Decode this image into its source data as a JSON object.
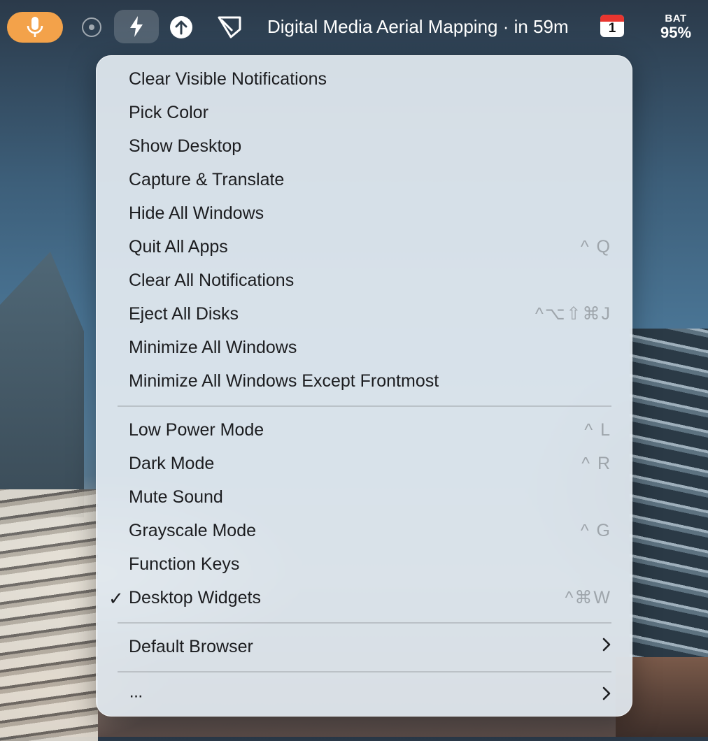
{
  "menubar": {
    "event_text": "Digital Media Aerial Mapping · in 59m",
    "calendar_day": "1",
    "battery_label": "BAT",
    "battery_percent": "95%",
    "mic_color": "#f3a24a"
  },
  "menu": {
    "group1": [
      {
        "label": "Clear Visible Notifications",
        "shortcut": ""
      },
      {
        "label": "Pick Color",
        "shortcut": ""
      },
      {
        "label": "Show Desktop",
        "shortcut": ""
      },
      {
        "label": "Capture & Translate",
        "shortcut": ""
      },
      {
        "label": "Hide All Windows",
        "shortcut": ""
      },
      {
        "label": "Quit All Apps",
        "shortcut": "^ Q"
      },
      {
        "label": "Clear All Notifications",
        "shortcut": ""
      },
      {
        "label": "Eject All Disks",
        "shortcut": "^⌥⇧⌘J"
      },
      {
        "label": "Minimize All Windows",
        "shortcut": ""
      },
      {
        "label": "Minimize All Windows Except Frontmost",
        "shortcut": ""
      }
    ],
    "group2": [
      {
        "label": "Low Power Mode",
        "shortcut": "^ L"
      },
      {
        "label": "Dark Mode",
        "shortcut": "^ R"
      },
      {
        "label": "Mute Sound",
        "shortcut": ""
      },
      {
        "label": "Grayscale Mode",
        "shortcut": "^ G"
      },
      {
        "label": "Function Keys",
        "shortcut": ""
      },
      {
        "label": "Desktop Widgets",
        "shortcut": "^⌘W",
        "checked": true,
        "check_glyph": "✓"
      }
    ],
    "default_browser": {
      "label": "Default Browser",
      "chevron": "›"
    },
    "more": {
      "label": "···",
      "chevron": "›"
    }
  }
}
